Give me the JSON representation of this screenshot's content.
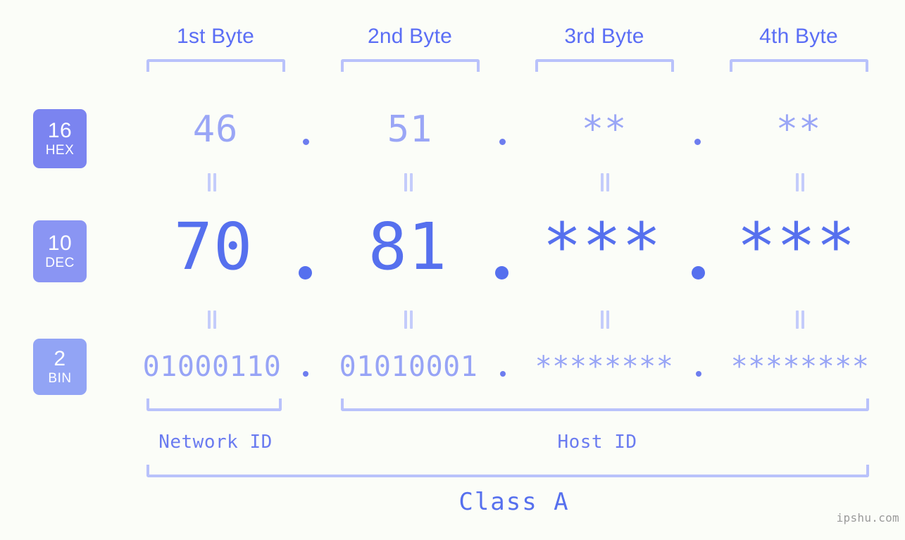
{
  "colors": {
    "background": "#fbfdf8",
    "accent_strong": "#5670ee",
    "accent_mid": "#6a7bf0",
    "accent_light": "#9aa6f6",
    "bracket": "#b9c2fb",
    "badge_hex": "#7b84f0",
    "badge_dec": "#8a95f3",
    "badge_bin": "#92a4f5",
    "watermark": "#9a9a9a"
  },
  "byte_headers": [
    {
      "label": "1st Byte"
    },
    {
      "label": "2nd Byte"
    },
    {
      "label": "3rd Byte"
    },
    {
      "label": "4th Byte"
    }
  ],
  "bases": [
    {
      "number": "16",
      "name": "HEX"
    },
    {
      "number": "10",
      "name": "DEC"
    },
    {
      "number": "2",
      "name": "BIN"
    }
  ],
  "rows": {
    "hex": {
      "base_number": "16",
      "base_name": "HEX",
      "values": [
        "46",
        "51",
        "**",
        "**"
      ]
    },
    "dec": {
      "base_number": "10",
      "base_name": "DEC",
      "values": [
        "70",
        "81",
        "***",
        "***"
      ]
    },
    "bin": {
      "base_number": "2",
      "base_name": "BIN",
      "values": [
        "01000110",
        "01010001",
        "********",
        "********"
      ]
    }
  },
  "separator": ".",
  "equals_sign": "=",
  "segments": {
    "network_id": "Network ID",
    "host_id": "Host ID"
  },
  "class_label": "Class A",
  "watermark": "ipshu.com"
}
